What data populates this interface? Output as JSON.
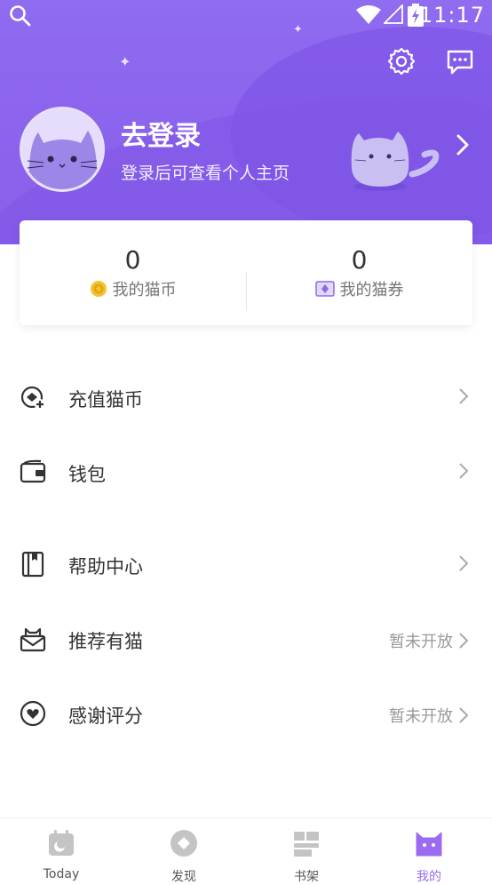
{
  "status": {
    "time": "11:17"
  },
  "profile": {
    "title": "去登录",
    "subtitle": "登录后可查看个人主页"
  },
  "stats": [
    {
      "value": "0",
      "label": "我的猫币",
      "icon": "coin-icon"
    },
    {
      "value": "0",
      "label": "我的猫券",
      "icon": "ticket-icon"
    }
  ],
  "menu": [
    {
      "label": "充值猫币",
      "right": "",
      "icon": "recharge-icon"
    },
    {
      "label": "钱包",
      "right": "",
      "icon": "wallet-icon"
    },
    {
      "label": "帮助中心",
      "right": "",
      "icon": "book-icon"
    },
    {
      "label": "推荐有猫",
      "right": "暂未开放",
      "icon": "mail-cat-icon"
    },
    {
      "label": "感谢评分",
      "right": "暂未开放",
      "icon": "heart-icon"
    }
  ],
  "tabs": [
    {
      "label": "Today",
      "icon": "calendar-icon",
      "active": false
    },
    {
      "label": "发现",
      "icon": "discover-icon",
      "active": false
    },
    {
      "label": "书架",
      "icon": "bookshelf-icon",
      "active": false
    },
    {
      "label": "我的",
      "icon": "cat-face-icon",
      "active": true
    }
  ],
  "colors": {
    "header": "#8d64ee",
    "accent": "#9b6cf2",
    "text": "#333333",
    "muted": "#9a9a9a"
  }
}
